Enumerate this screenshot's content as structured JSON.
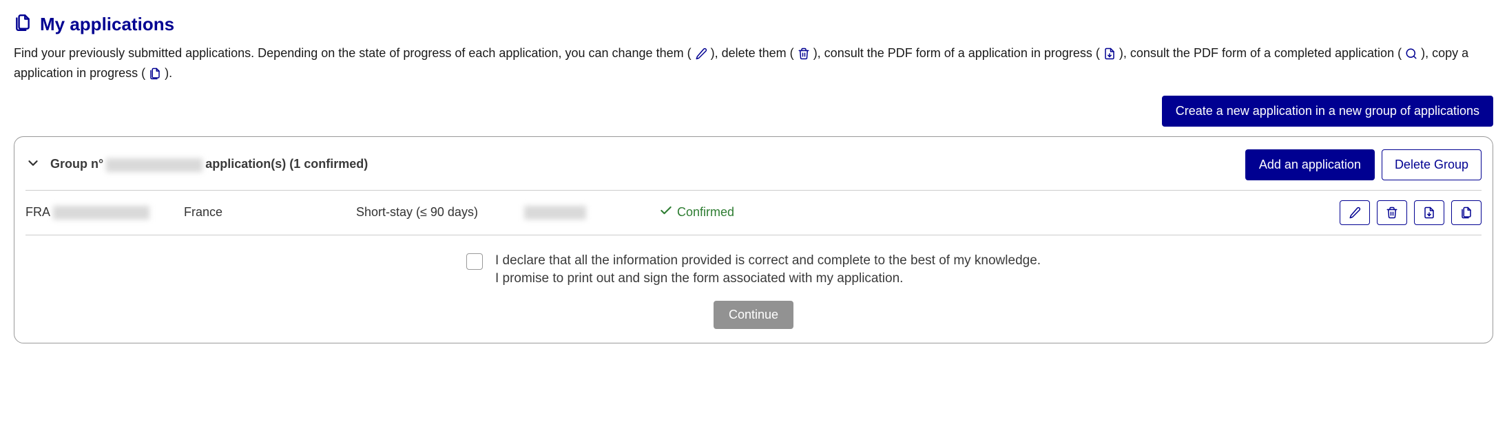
{
  "page": {
    "title": "My applications",
    "intro_parts": {
      "p1": "Find your previously submitted applications. Depending on the state of progress of each application, you can change them ( ",
      "p2": " ), delete them ( ",
      "p3": " ), consult the PDF form of a application in progress ( ",
      "p4": " ), consult the PDF form of a completed application ( ",
      "p5": " ), copy a application in progress ( ",
      "p6": " )."
    }
  },
  "actions": {
    "create_group": "Create a new application in a new group of applications",
    "add_application": "Add an application",
    "delete_group": "Delete Group",
    "continue": "Continue"
  },
  "group": {
    "prefix": "Group n°",
    "suffix": "application(s) (1 confirmed)"
  },
  "row": {
    "ref_prefix": "FRA",
    "country": "France",
    "stay": "Short-stay (≤ 90 days)",
    "status": "Confirmed"
  },
  "declaration": {
    "line1": "I declare that all the information provided is correct and complete to the best of my knowledge.",
    "line2": "I promise to print out and sign the form associated with my application."
  }
}
